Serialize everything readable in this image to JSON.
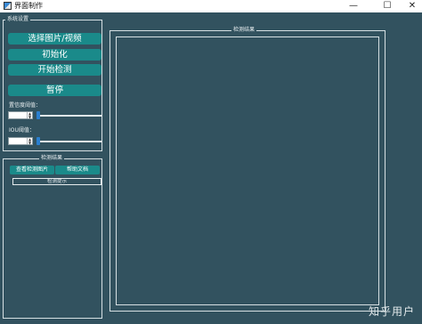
{
  "window": {
    "title": "界面制作",
    "minimize": "—",
    "maximize": "☐",
    "close": "✕"
  },
  "settings_group": {
    "title": "系统设置",
    "select_button": "选择图片/视频",
    "init_button": "初始化",
    "start_button": "开始检测",
    "pause_button": "暂停",
    "confidence_label": "置信度阈值：",
    "confidence_value": "",
    "iou_label": "IOU阈值：",
    "iou_value": ""
  },
  "results_group": {
    "title": "检测结果",
    "view_button": "查看检测图片",
    "help_button": "帮助文档",
    "hint_text": "检测提示"
  },
  "display_group": {
    "title": "检测结果"
  },
  "watermark": "知乎用户"
}
